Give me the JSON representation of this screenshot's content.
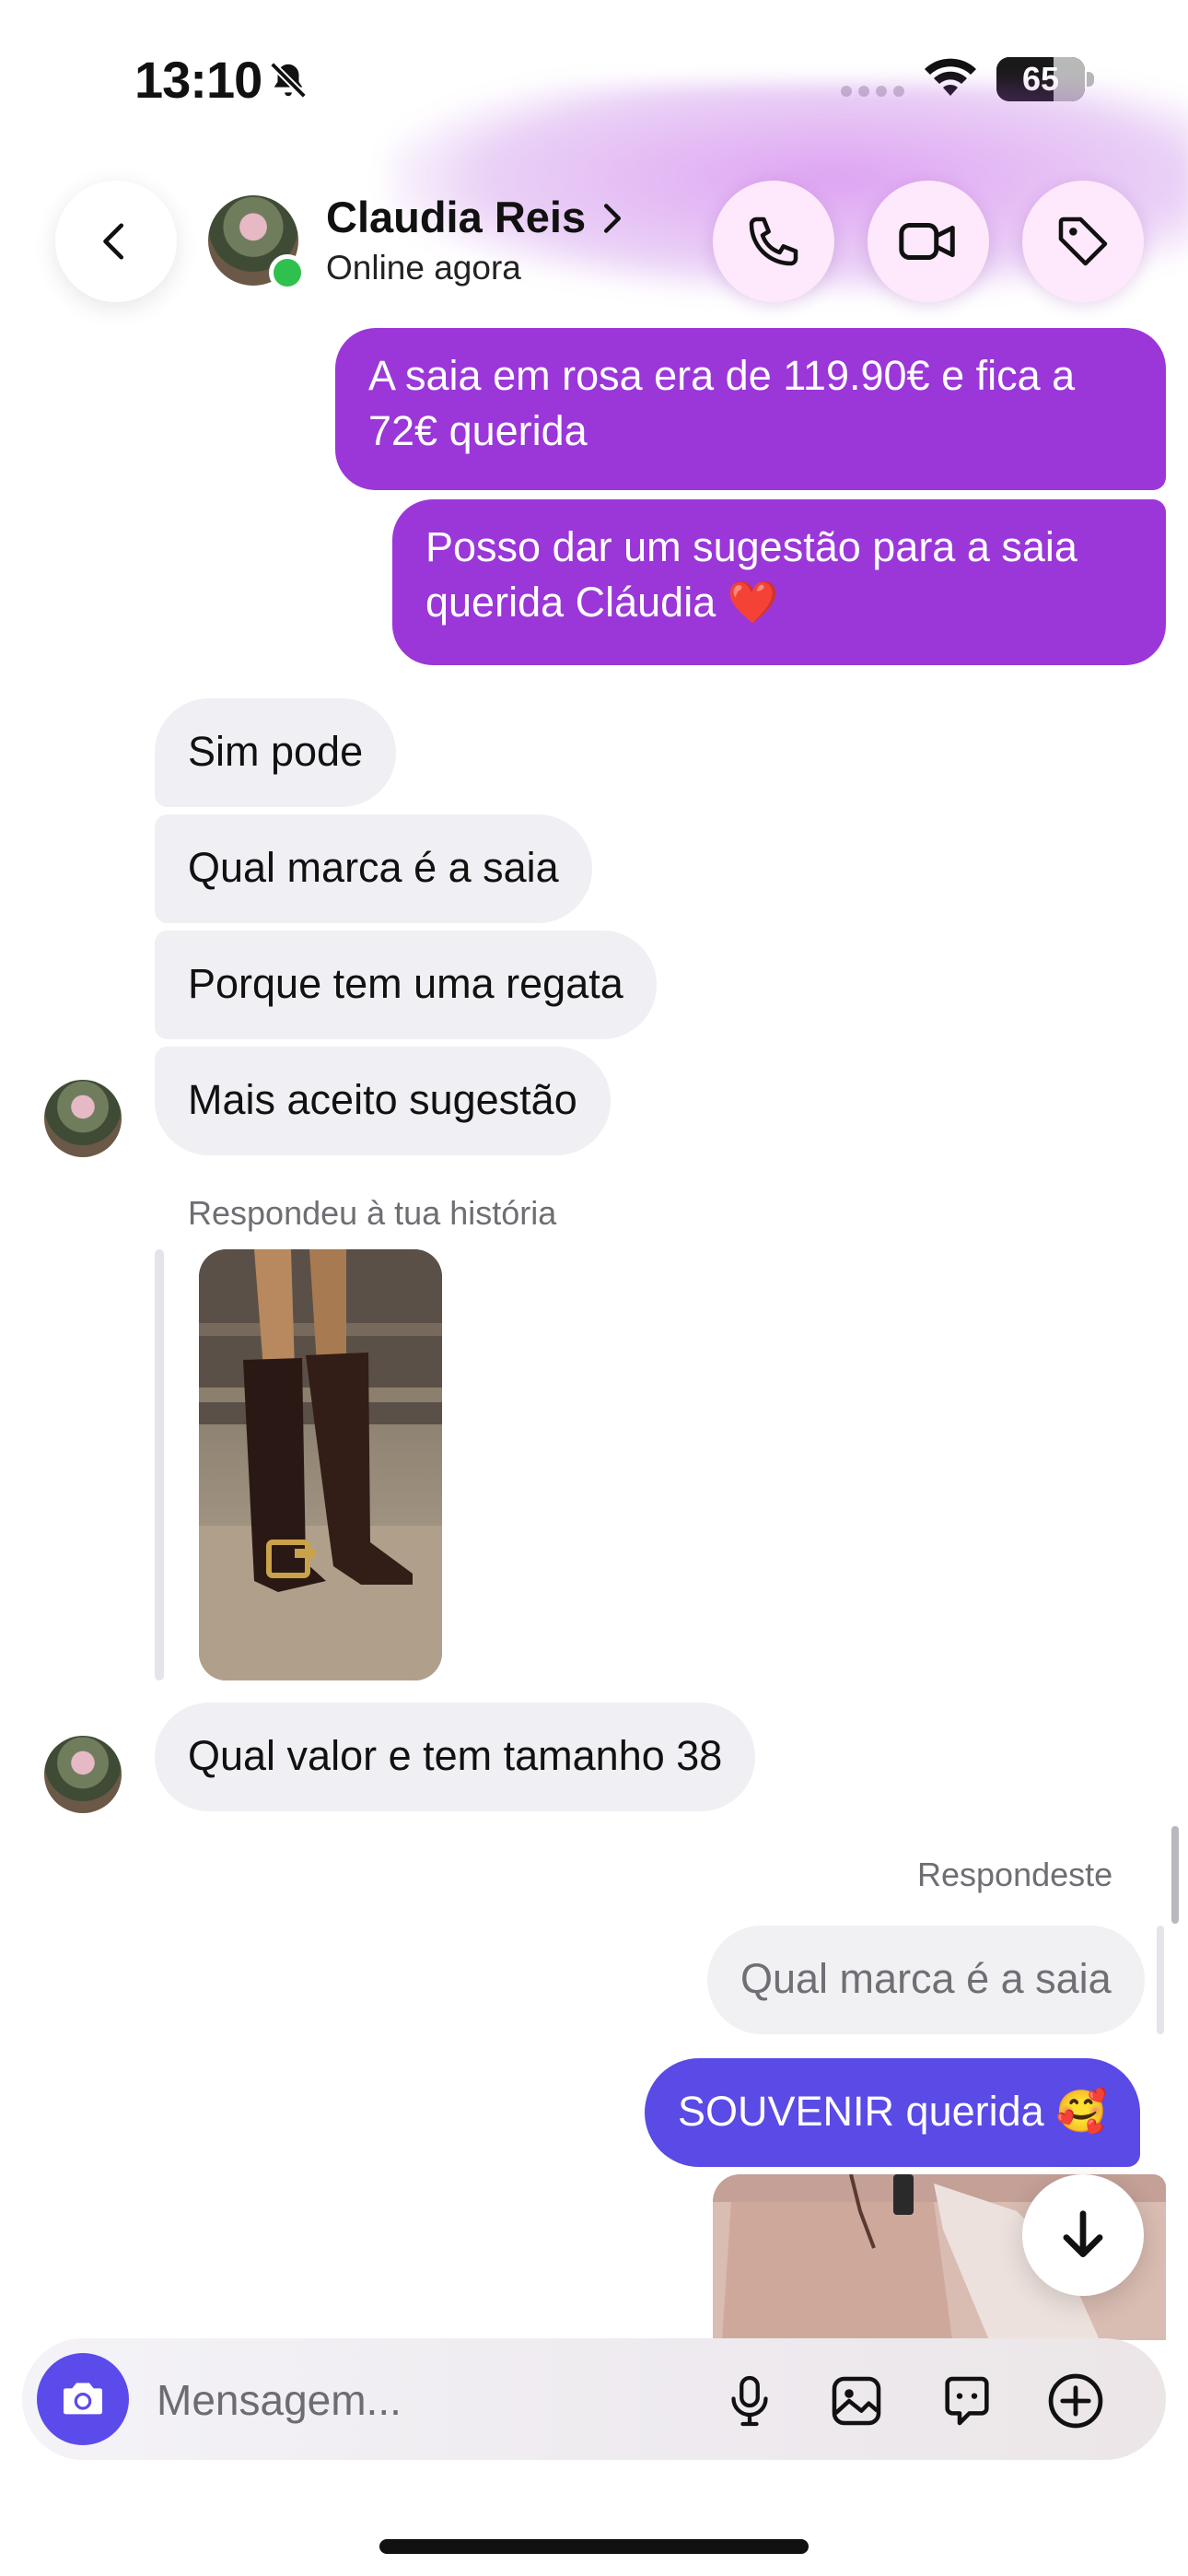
{
  "status_bar": {
    "time": "13:10",
    "battery": "65",
    "battery_level": 0.65,
    "icons": [
      "bell-slash-icon",
      "signal-dots-icon",
      "wifi-icon",
      "battery-icon"
    ]
  },
  "header": {
    "contact_name": "Claudia Reis",
    "contact_status": "Online agora",
    "icons": [
      "back-icon",
      "phone-icon",
      "video-icon",
      "tag-icon",
      "chevron-right-icon"
    ],
    "accent_color": "#9b37d9"
  },
  "messages": {
    "out_1": "A saia em rosa era de 119.90€ e fica a 72€ querida",
    "out_2": "Posso dar um sugestão para a saia querida Cláudia ❤️",
    "in_1": "Sim pode",
    "in_2": "Qual marca é a saia",
    "in_3": "Porque tem uma regata",
    "in_4": "Mais aceito sugestão",
    "story_label": "Respondeu à tua história",
    "in_5": "Qual valor e tem tamanho 38",
    "reply_label": "Respondeste",
    "reply_quote": "Qual marca é a saia",
    "out_3": "SOUVENIR querida 🥰"
  },
  "composer": {
    "placeholder": "Mensagem...",
    "icons": [
      "camera-icon",
      "microphone-icon",
      "gallery-icon",
      "sticker-icon",
      "plus-icon"
    ]
  },
  "colors": {
    "outgoing_purple": "#9b37d9",
    "outgoing_blue": "#5a4ae6",
    "incoming_grey": "#efeff4",
    "online_green": "#2fc14d"
  }
}
